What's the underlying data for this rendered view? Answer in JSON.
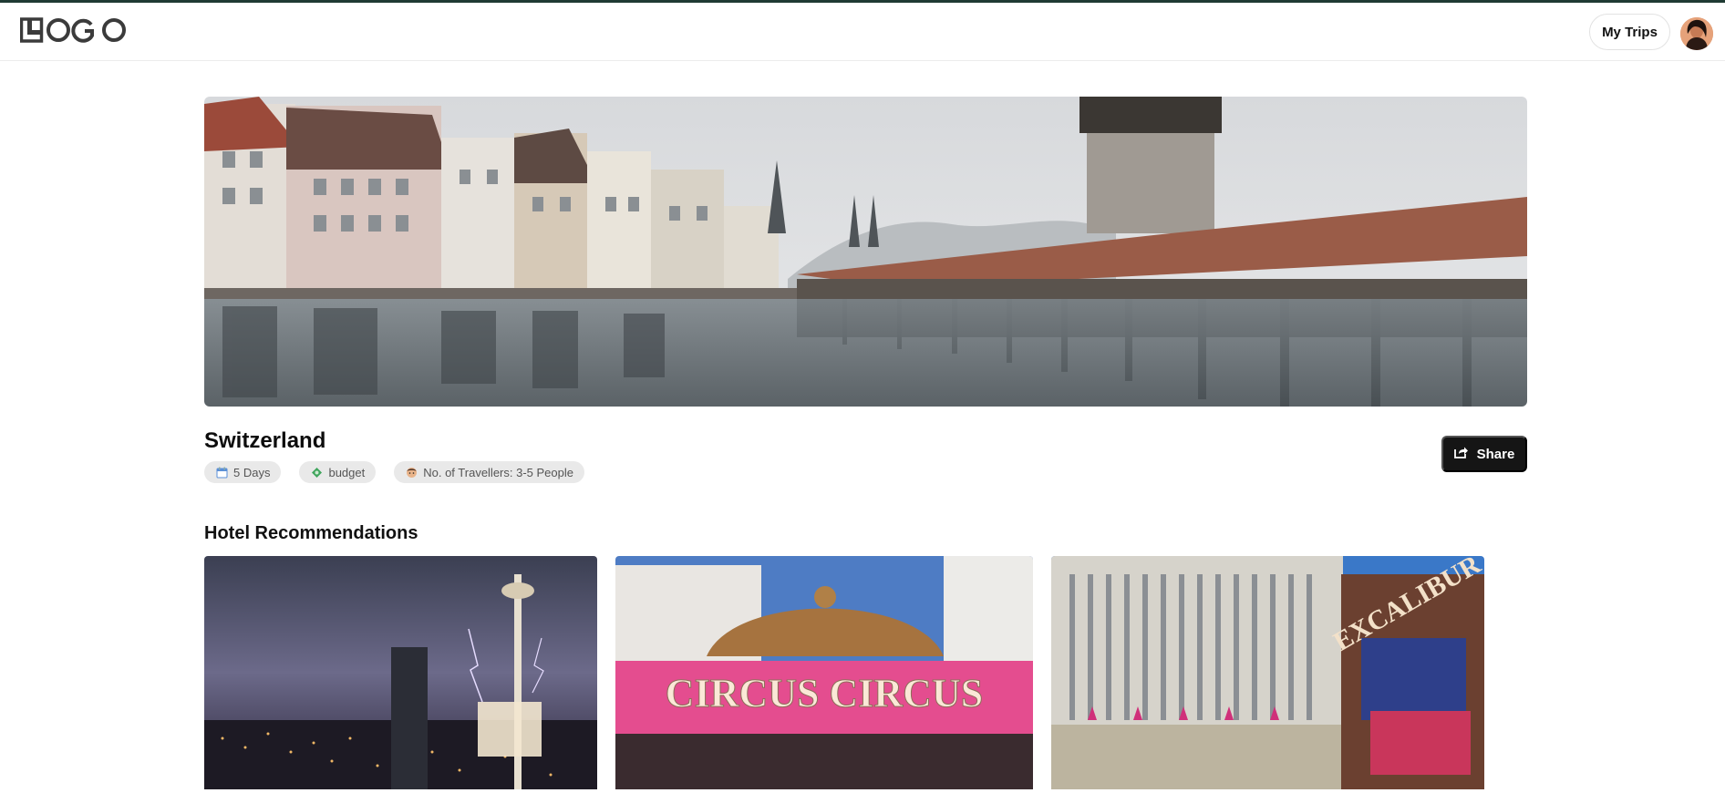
{
  "header": {
    "logo_text": "LOGO",
    "my_trips_label": "My Trips",
    "avatar": "user-avatar"
  },
  "trip": {
    "title": "Switzerland",
    "chips": [
      {
        "icon": "calendar-icon",
        "label": "5 Days"
      },
      {
        "icon": "money-icon",
        "label": "budget"
      },
      {
        "icon": "traveller-icon",
        "label": "No. of Travellers: 3-5 People"
      }
    ],
    "share_label": "Share"
  },
  "hotels": {
    "section_title": "Hotel Recommendations"
  },
  "colors": {
    "accent_dark": "#151515",
    "chip_bg": "#e9e9e9",
    "top_border": "#1f3a33"
  }
}
